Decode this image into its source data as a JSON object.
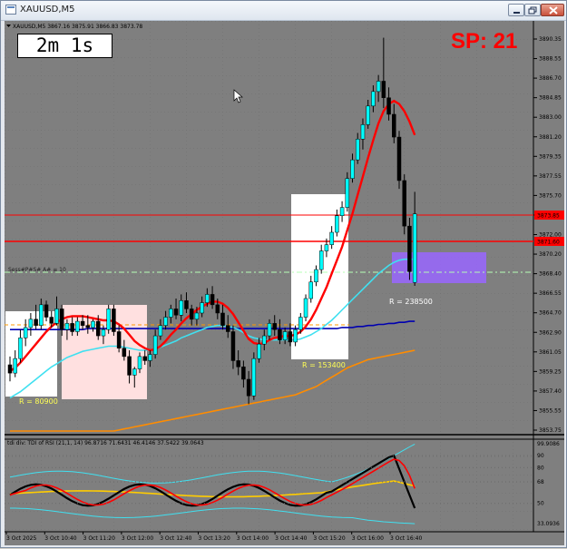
{
  "window": {
    "title": "XAUUSD,M5"
  },
  "main_header": "XAUUSD,M5  3867.16 3875.91 3866.83 3873.78",
  "timer": "2m 1s",
  "spread": "SP: 21",
  "price_axis": [
    "3890.35",
    "3888.55",
    "3886.70",
    "3884.85",
    "3883.00",
    "3881.20",
    "3879.35",
    "3877.55",
    "3875.70",
    "3873.85",
    "3872.00",
    "3870.20",
    "3868.40",
    "3866.55",
    "3864.70",
    "3862.90",
    "3861.05",
    "3859.25",
    "3857.40",
    "3855.55",
    "3853.75"
  ],
  "price_tags": {
    "ask": "3873.85",
    "bid": "3871.60"
  },
  "hline_label": "Sess#P#S# A# ≡ 10",
  "boxes": [
    {
      "label": "R = 80900"
    },
    {
      "label": "R = 153400"
    },
    {
      "label": "R = 238500"
    }
  ],
  "sub_header": "tdi div: TDI of RSI  (21,1, 14) 96.8716 71.6431 46.4146 37.5422 39.0643",
  "sub_axis": [
    "99.9086",
    "90",
    "80",
    "68",
    "50",
    "33.0936"
  ],
  "time_axis": [
    "3 Oct 2025",
    "3 Oct 10:40",
    "3 Oct 11:20",
    "3 Oct 12:00",
    "3 Oct 12:40",
    "3 Oct 13:20",
    "3 Oct 14:00",
    "3 Oct 14:40",
    "3 Oct 15:20",
    "3 Oct 16:00",
    "3 Oct 16:40"
  ],
  "colors": {
    "bull": "#00ffff",
    "bear": "#000000",
    "ma_fast": "#ff0000",
    "ma_mid": "#40e0f0",
    "ma_slow": "#0000b0",
    "ma_long": "#ff8c00",
    "spread": "#ff0000",
    "box_purple": "#9966ff"
  },
  "chart_data": {
    "type": "candlestick",
    "symbol": "XAUUSD",
    "timeframe": "M5",
    "ylim": [
      3852.8,
      3891.2
    ],
    "candles": [
      [
        3859.2,
        3860.0,
        3857.6,
        3858.4
      ],
      [
        3858.4,
        3860.6,
        3858.0,
        3859.8
      ],
      [
        3859.8,
        3862.6,
        3859.4,
        3861.8
      ],
      [
        3861.8,
        3863.6,
        3861.0,
        3862.8
      ],
      [
        3862.8,
        3864.2,
        3862.0,
        3863.6
      ],
      [
        3863.6,
        3865.0,
        3862.6,
        3863.0
      ],
      [
        3863.0,
        3865.6,
        3862.6,
        3865.0
      ],
      [
        3865.0,
        3865.4,
        3863.4,
        3863.8
      ],
      [
        3863.8,
        3864.4,
        3862.8,
        3863.2
      ],
      [
        3863.2,
        3865.8,
        3863.0,
        3864.6
      ],
      [
        3864.6,
        3865.0,
        3862.0,
        3862.6
      ],
      [
        3862.6,
        3863.6,
        3861.6,
        3863.2
      ],
      [
        3863.2,
        3863.8,
        3862.0,
        3862.4
      ],
      [
        3862.4,
        3863.8,
        3862.0,
        3863.4
      ],
      [
        3863.4,
        3864.0,
        3862.6,
        3863.0
      ],
      [
        3863.0,
        3864.0,
        3862.2,
        3862.8
      ],
      [
        3862.8,
        3863.6,
        3862.4,
        3863.4
      ],
      [
        3863.4,
        3864.0,
        3861.6,
        3862.0
      ],
      [
        3862.0,
        3863.0,
        3861.2,
        3862.6
      ],
      [
        3862.6,
        3865.0,
        3862.2,
        3864.6
      ],
      [
        3864.6,
        3865.0,
        3862.0,
        3862.4
      ],
      [
        3862.4,
        3863.0,
        3860.4,
        3860.8
      ],
      [
        3860.8,
        3861.6,
        3859.6,
        3860.0
      ],
      [
        3860.0,
        3860.6,
        3857.4,
        3858.2
      ],
      [
        3858.2,
        3859.0,
        3857.0,
        3858.8
      ],
      [
        3858.8,
        3860.4,
        3858.4,
        3860.0
      ],
      [
        3860.0,
        3860.6,
        3859.2,
        3859.6
      ],
      [
        3859.6,
        3860.6,
        3859.0,
        3860.2
      ],
      [
        3860.2,
        3862.6,
        3859.8,
        3862.0
      ],
      [
        3862.0,
        3863.6,
        3861.6,
        3863.0
      ],
      [
        3863.0,
        3864.4,
        3862.6,
        3863.8
      ],
      [
        3863.8,
        3865.0,
        3863.2,
        3864.6
      ],
      [
        3864.6,
        3865.6,
        3863.6,
        3864.0
      ],
      [
        3864.0,
        3866.0,
        3863.4,
        3865.4
      ],
      [
        3865.4,
        3866.2,
        3864.2,
        3864.6
      ],
      [
        3864.6,
        3865.0,
        3863.0,
        3863.6
      ],
      [
        3863.6,
        3864.8,
        3863.0,
        3864.2
      ],
      [
        3864.2,
        3865.8,
        3863.8,
        3865.2
      ],
      [
        3865.2,
        3866.6,
        3864.8,
        3866.0
      ],
      [
        3866.0,
        3866.8,
        3864.6,
        3865.0
      ],
      [
        3865.0,
        3865.6,
        3863.6,
        3864.2
      ],
      [
        3864.2,
        3865.0,
        3862.6,
        3863.0
      ],
      [
        3863.0,
        3864.0,
        3861.8,
        3862.4
      ],
      [
        3862.4,
        3863.0,
        3858.8,
        3859.6
      ],
      [
        3859.6,
        3860.6,
        3858.2,
        3859.0
      ],
      [
        3859.0,
        3859.6,
        3857.0,
        3857.8
      ],
      [
        3857.8,
        3858.6,
        3855.4,
        3856.2
      ],
      [
        3856.2,
        3860.4,
        3855.8,
        3859.8
      ],
      [
        3859.8,
        3861.8,
        3859.4,
        3861.2
      ],
      [
        3861.2,
        3862.6,
        3860.6,
        3862.0
      ],
      [
        3862.0,
        3863.6,
        3861.6,
        3863.2
      ],
      [
        3863.2,
        3864.0,
        3862.0,
        3862.6
      ],
      [
        3862.6,
        3863.6,
        3861.2,
        3861.6
      ],
      [
        3861.6,
        3862.8,
        3861.2,
        3862.4
      ],
      [
        3862.4,
        3863.2,
        3861.0,
        3861.4
      ],
      [
        3861.4,
        3863.0,
        3861.0,
        3862.6
      ],
      [
        3862.6,
        3864.2,
        3862.2,
        3863.8
      ],
      [
        3863.8,
        3866.0,
        3863.4,
        3865.6
      ],
      [
        3865.6,
        3867.8,
        3865.2,
        3867.2
      ],
      [
        3867.2,
        3868.8,
        3866.8,
        3868.4
      ],
      [
        3868.4,
        3870.8,
        3868.0,
        3870.2
      ],
      [
        3870.2,
        3871.4,
        3869.6,
        3870.8
      ],
      [
        3870.8,
        3872.6,
        3870.4,
        3872.0
      ],
      [
        3872.0,
        3874.2,
        3871.6,
        3873.6
      ],
      [
        3873.6,
        3875.0,
        3873.0,
        3874.4
      ],
      [
        3874.4,
        3877.8,
        3874.0,
        3877.2
      ],
      [
        3877.2,
        3879.6,
        3876.8,
        3879.0
      ],
      [
        3879.0,
        3881.6,
        3878.6,
        3881.0
      ],
      [
        3881.0,
        3883.0,
        3880.0,
        3882.4
      ],
      [
        3882.4,
        3884.8,
        3882.0,
        3884.2
      ],
      [
        3884.2,
        3886.2,
        3883.6,
        3885.6
      ],
      [
        3885.6,
        3887.2,
        3884.6,
        3886.6
      ],
      [
        3886.6,
        3890.8,
        3884.0,
        3885.0
      ],
      [
        3885.0,
        3886.0,
        3882.8,
        3883.4
      ],
      [
        3883.4,
        3884.4,
        3880.6,
        3881.2
      ],
      [
        3881.2,
        3881.8,
        3876.2,
        3877.0
      ],
      [
        3877.0,
        3877.6,
        3871.8,
        3872.6
      ],
      [
        3872.6,
        3873.4,
        3867.4,
        3868.2
      ],
      [
        3867.16,
        3875.91,
        3866.83,
        3873.78
      ]
    ],
    "ma_fast": [
      3858.6,
      3858.9,
      3859.4,
      3860.0,
      3860.6,
      3861.2,
      3861.8,
      3862.4,
      3862.9,
      3863.3,
      3863.6,
      3863.8,
      3863.9,
      3863.9,
      3863.9,
      3863.8,
      3863.7,
      3863.6,
      3863.5,
      3863.5,
      3863.4,
      3863.1,
      3862.7,
      3862.1,
      3861.5,
      3861.1,
      3860.8,
      3860.6,
      3860.7,
      3861.0,
      3861.5,
      3862.1,
      3862.6,
      3863.2,
      3863.7,
      3864.1,
      3864.5,
      3864.8,
      3865.1,
      3865.3,
      3865.3,
      3865.1,
      3864.7,
      3864.1,
      3863.3,
      3862.5,
      3861.7,
      3861.3,
      3861.2,
      3861.3,
      3861.6,
      3861.8,
      3861.9,
      3862.0,
      3862.0,
      3862.1,
      3862.4,
      3862.9,
      3863.6,
      3864.5,
      3865.6,
      3866.7,
      3868.0,
      3869.3,
      3870.6,
      3872.2,
      3873.8,
      3875.6,
      3877.4,
      3879.2,
      3880.9,
      3882.5,
      3883.7,
      3884.4,
      3884.7,
      3884.4,
      3883.7,
      3882.7,
      3881.4
    ],
    "ma_mid": [
      3856.0,
      3856.3,
      3856.6,
      3857.0,
      3857.4,
      3857.8,
      3858.2,
      3858.6,
      3859.0,
      3859.3,
      3859.6,
      3859.9,
      3860.1,
      3860.3,
      3860.5,
      3860.6,
      3860.7,
      3860.8,
      3860.9,
      3861.0,
      3861.0,
      3861.0,
      3860.9,
      3860.8,
      3860.7,
      3860.6,
      3860.6,
      3860.6,
      3860.7,
      3860.9,
      3861.1,
      3861.3,
      3861.5,
      3861.8,
      3862.0,
      3862.2,
      3862.4,
      3862.6,
      3862.8,
      3862.9,
      3863.0,
      3863.0,
      3862.9,
      3862.8,
      3862.6,
      3862.3,
      3862.0,
      3861.8,
      3861.7,
      3861.6,
      3861.6,
      3861.6,
      3861.6,
      3861.6,
      3861.6,
      3861.6,
      3861.7,
      3861.9,
      3862.1,
      3862.4,
      3862.7,
      3863.1,
      3863.5,
      3864.0,
      3864.5,
      3865.0,
      3865.5,
      3866.0,
      3866.5,
      3867.0,
      3867.5,
      3868.0,
      3868.4,
      3868.8,
      3869.1,
      3869.3,
      3869.4,
      3869.4,
      3869.4
    ],
    "ma_slow": [
      3862.6,
      3862.6,
      3862.6,
      3862.6,
      3862.6,
      3862.6,
      3862.6,
      3862.6,
      3862.6,
      3862.6,
      3862.6,
      3862.6,
      3862.6,
      3862.6,
      3862.6,
      3862.7,
      3862.7,
      3862.7,
      3862.7,
      3862.7,
      3862.7,
      3862.7,
      3862.7,
      3862.7,
      3862.7,
      3862.7,
      3862.7,
      3862.7,
      3862.7,
      3862.7,
      3862.7,
      3862.7,
      3862.7,
      3862.7,
      3862.7,
      3862.7,
      3862.7,
      3862.7,
      3862.7,
      3862.7,
      3862.7,
      3862.7,
      3862.7,
      3862.7,
      3862.7,
      3862.7,
      3862.7,
      3862.7,
      3862.7,
      3862.7,
      3862.7,
      3862.7,
      3862.7,
      3862.7,
      3862.7,
      3862.7,
      3862.7,
      3862.7,
      3862.7,
      3862.7,
      3862.7,
      3862.7,
      3862.7,
      3862.7,
      3862.8,
      3862.8,
      3862.8,
      3862.9,
      3862.9,
      3863.0,
      3863.0,
      3863.1,
      3863.1,
      3863.2,
      3863.2,
      3863.3,
      3863.3,
      3863.4,
      3863.4
    ],
    "ma_long": [
      3852.8,
      3852.8,
      3852.8,
      3852.8,
      3852.8,
      3852.8,
      3852.8,
      3852.8,
      3852.8,
      3852.8,
      3852.8,
      3852.8,
      3852.8,
      3852.8,
      3852.8,
      3852.8,
      3852.8,
      3852.8,
      3852.8,
      3852.8,
      3852.8,
      3852.9,
      3853.0,
      3853.1,
      3853.2,
      3853.3,
      3853.4,
      3853.5,
      3853.6,
      3853.7,
      3853.8,
      3853.9,
      3854.0,
      3854.1,
      3854.2,
      3854.3,
      3854.4,
      3854.5,
      3854.6,
      3854.7,
      3854.8,
      3854.9,
      3855.0,
      3855.1,
      3855.2,
      3855.3,
      3855.4,
      3855.5,
      3855.6,
      3855.7,
      3855.8,
      3855.9,
      3856.0,
      3856.1,
      3856.2,
      3856.3,
      3856.5,
      3856.7,
      3856.9,
      3857.1,
      3857.4,
      3857.7,
      3858.0,
      3858.3,
      3858.6,
      3858.9,
      3859.1,
      3859.3,
      3859.5,
      3859.7,
      3859.8,
      3859.9,
      3860.0,
      3860.1,
      3860.2,
      3860.3,
      3860.4,
      3860.5,
      3860.6
    ]
  }
}
